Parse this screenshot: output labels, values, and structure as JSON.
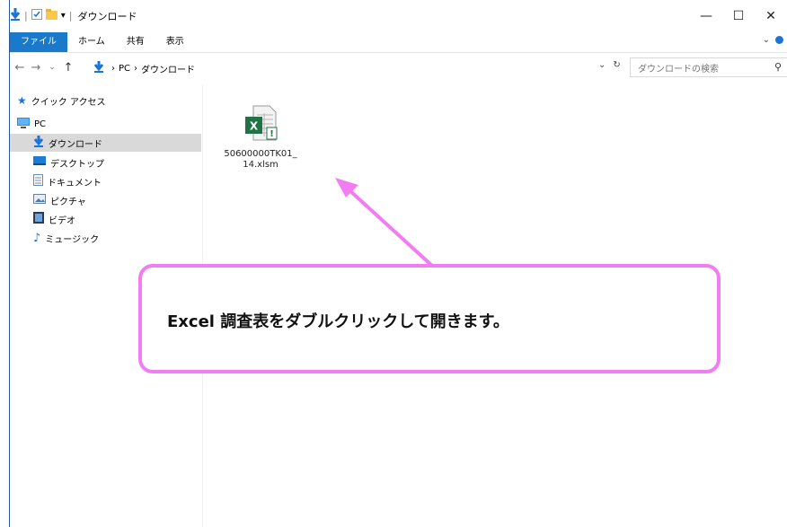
{
  "window": {
    "title": "ダウンロード",
    "controls": [
      "—",
      "☐",
      "✕"
    ]
  },
  "ribbon": {
    "tabs": [
      {
        "label": "ファイル",
        "active": true
      },
      {
        "label": "ホーム"
      },
      {
        "label": "共有"
      },
      {
        "label": "表示"
      }
    ]
  },
  "address": {
    "path": [
      "PC",
      "ダウンロード"
    ],
    "separator": "›",
    "search_placeholder": "ダウンロードの検索"
  },
  "sidebar": {
    "quick_access": "クイック アクセス",
    "pc": "PC",
    "items": [
      {
        "label": "ダウンロード",
        "icon": "download-arrow-icon",
        "selected": true
      },
      {
        "label": "デスクトップ",
        "icon": "desktop-icon"
      },
      {
        "label": "ドキュメント",
        "icon": "document-icon"
      },
      {
        "label": "ピクチャ",
        "icon": "picture-icon"
      },
      {
        "label": "ビデオ",
        "icon": "video-icon"
      },
      {
        "label": "ミュージック",
        "icon": "music-icon"
      }
    ]
  },
  "files": [
    {
      "name": "50600000TK01_14.xlsm",
      "icon": "excel-file-icon"
    }
  ],
  "callout": {
    "text": "Excel 調査表をダブルクリックして開きます。",
    "border_color": "#f27df2"
  },
  "colors": {
    "file_tab": "#1979ca",
    "accent_blue": "#1a73d8",
    "excel_green": "#217346"
  }
}
